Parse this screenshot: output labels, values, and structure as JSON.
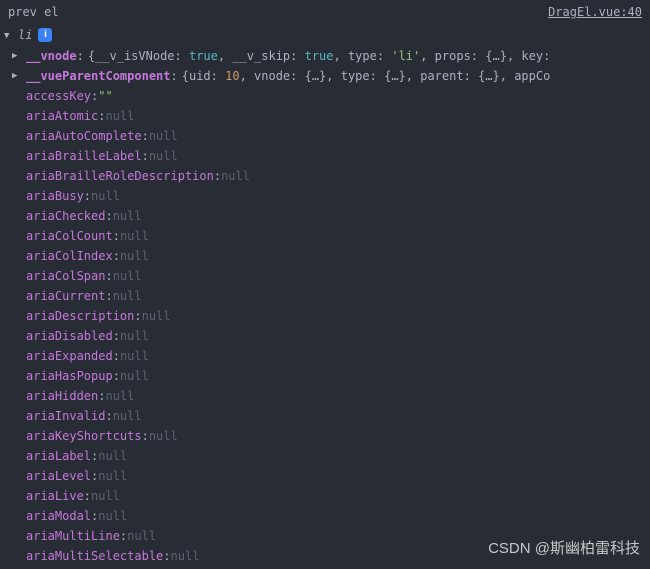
{
  "header": {
    "label": "prev el",
    "source": "DragEl.vue:40"
  },
  "root": {
    "name": "li",
    "info": "i"
  },
  "vnode": {
    "key": "__vnode",
    "preview": {
      "p1k": "__v_isVNode",
      "p1v": "true",
      "p2k": "__v_skip",
      "p2v": "true",
      "p3k": "type",
      "p3v": "'li'",
      "p4k": "props",
      "p4v": "{…}",
      "p5k": "key"
    }
  },
  "parent": {
    "key": "__vueParentComponent",
    "preview": {
      "p1k": "uid",
      "p1v": "10",
      "p2k": "vnode",
      "p2v": "{…}",
      "p3k": "type",
      "p3v": "{…}",
      "p4k": "parent",
      "p4v": "{…}",
      "p5k": "appCo"
    }
  },
  "props": [
    {
      "k": "accessKey",
      "v": "\"\"",
      "t": "str"
    },
    {
      "k": "ariaAtomic",
      "v": "null",
      "t": "null"
    },
    {
      "k": "ariaAutoComplete",
      "v": "null",
      "t": "null"
    },
    {
      "k": "ariaBrailleLabel",
      "v": "null",
      "t": "null"
    },
    {
      "k": "ariaBrailleRoleDescription",
      "v": "null",
      "t": "null"
    },
    {
      "k": "ariaBusy",
      "v": "null",
      "t": "null"
    },
    {
      "k": "ariaChecked",
      "v": "null",
      "t": "null"
    },
    {
      "k": "ariaColCount",
      "v": "null",
      "t": "null"
    },
    {
      "k": "ariaColIndex",
      "v": "null",
      "t": "null"
    },
    {
      "k": "ariaColSpan",
      "v": "null",
      "t": "null"
    },
    {
      "k": "ariaCurrent",
      "v": "null",
      "t": "null"
    },
    {
      "k": "ariaDescription",
      "v": "null",
      "t": "null"
    },
    {
      "k": "ariaDisabled",
      "v": "null",
      "t": "null"
    },
    {
      "k": "ariaExpanded",
      "v": "null",
      "t": "null"
    },
    {
      "k": "ariaHasPopup",
      "v": "null",
      "t": "null"
    },
    {
      "k": "ariaHidden",
      "v": "null",
      "t": "null"
    },
    {
      "k": "ariaInvalid",
      "v": "null",
      "t": "null"
    },
    {
      "k": "ariaKeyShortcuts",
      "v": "null",
      "t": "null"
    },
    {
      "k": "ariaLabel",
      "v": "null",
      "t": "null"
    },
    {
      "k": "ariaLevel",
      "v": "null",
      "t": "null"
    },
    {
      "k": "ariaLive",
      "v": "null",
      "t": "null"
    },
    {
      "k": "ariaModal",
      "v": "null",
      "t": "null"
    },
    {
      "k": "ariaMultiLine",
      "v": "null",
      "t": "null"
    },
    {
      "k": "ariaMultiSelectable",
      "v": "null",
      "t": "null"
    }
  ],
  "watermark": "CSDN @斯幽柏雷科技"
}
